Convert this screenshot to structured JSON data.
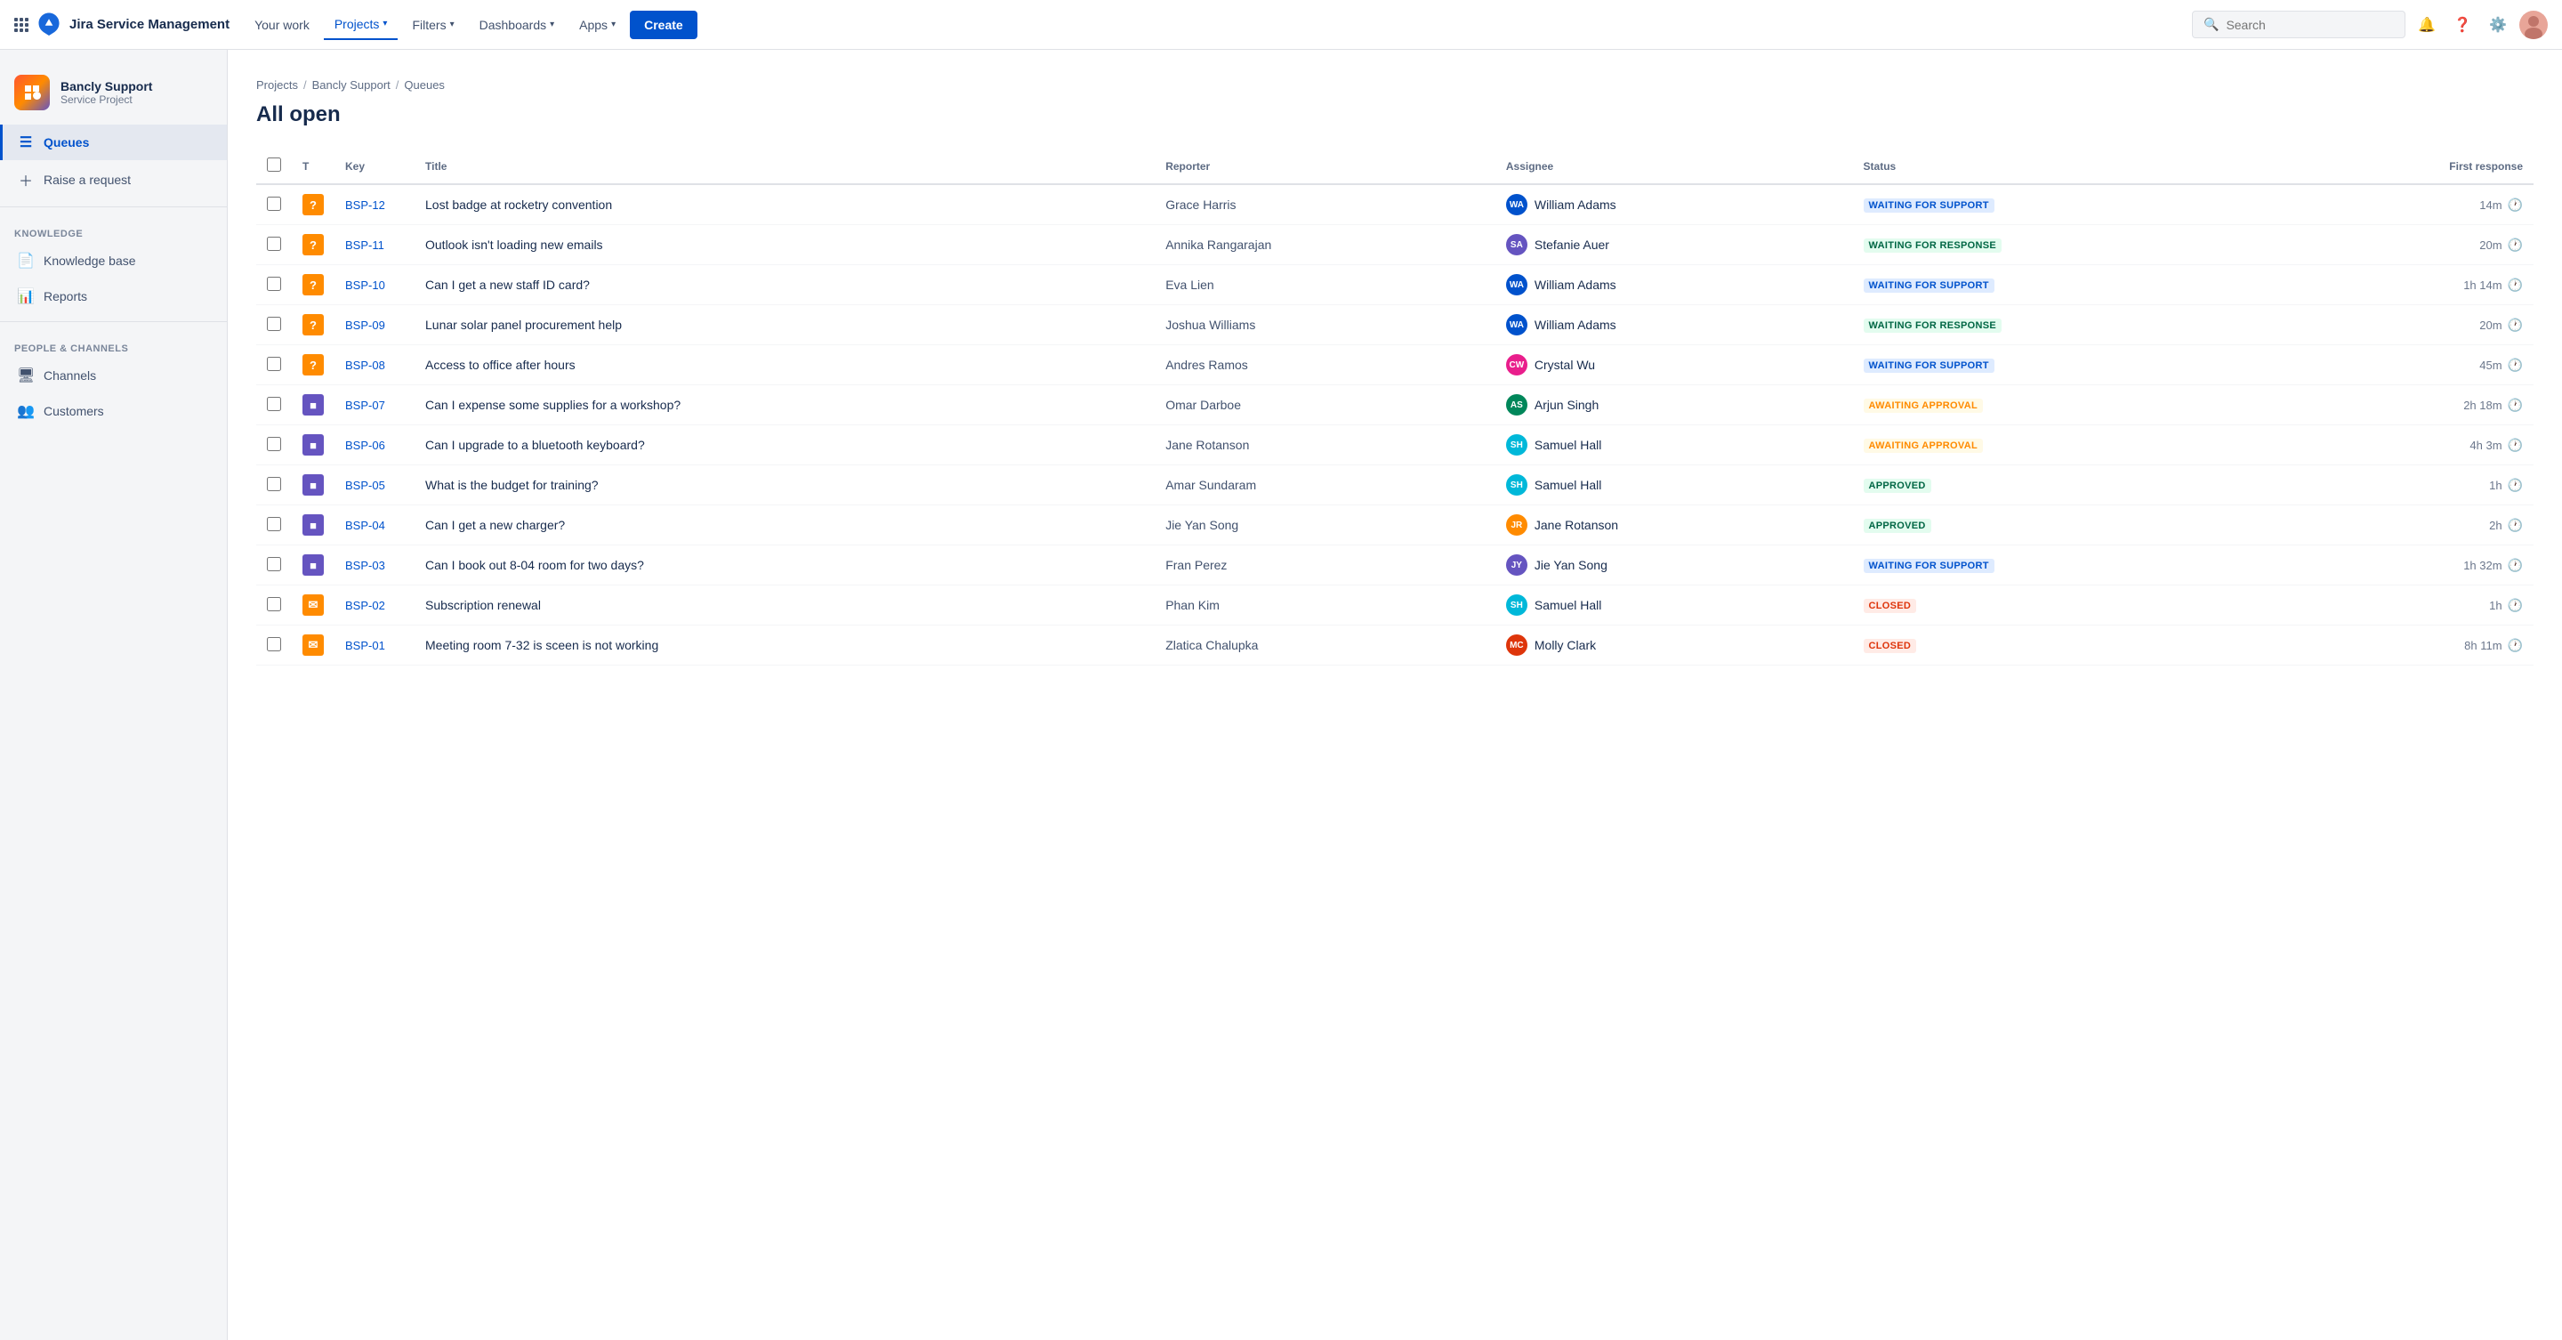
{
  "topnav": {
    "app_name": "Jira Service Management",
    "your_work": "Your work",
    "projects": "Projects",
    "filters": "Filters",
    "dashboards": "Dashboards",
    "apps": "Apps",
    "create": "Create",
    "search_placeholder": "Search"
  },
  "sidebar": {
    "project_name": "Bancly Support",
    "project_type": "Service Project",
    "queues_label": "Queues",
    "raise_request_label": "Raise a request",
    "knowledge_section": "KNOWLEDGE",
    "knowledge_base_label": "Knowledge base",
    "reports_label": "Reports",
    "people_channels_section": "PEOPLE & CHANNELS",
    "channels_label": "Channels",
    "customers_label": "Customers"
  },
  "breadcrumb": {
    "projects": "Projects",
    "bancly_support": "Bancly Support",
    "queues": "Queues"
  },
  "page_title": "All open",
  "table": {
    "cols": {
      "type": "T",
      "key": "Key",
      "title": "Title",
      "reporter": "Reporter",
      "assignee": "Assignee",
      "status": "Status",
      "first_response": "First response"
    },
    "rows": [
      {
        "key": "BSP-12",
        "type": "question",
        "title": "Lost badge at rocketry convention",
        "reporter": "Grace Harris",
        "assignee": "William Adams",
        "assignee_initials": "WA",
        "assignee_color": "av-blue",
        "status": "WAITING FOR SUPPORT",
        "status_class": "status-waiting-support",
        "first_response": "14m"
      },
      {
        "key": "BSP-11",
        "type": "question",
        "title": "Outlook isn't loading new emails",
        "reporter": "Annika Rangarajan",
        "assignee": "Stefanie Auer",
        "assignee_initials": "SA",
        "assignee_color": "av-purple",
        "status": "WAITING FOR RESPONSE",
        "status_class": "status-waiting-response",
        "first_response": "20m"
      },
      {
        "key": "BSP-10",
        "type": "question",
        "title": "Can I get a new staff ID card?",
        "reporter": "Eva Lien",
        "assignee": "William Adams",
        "assignee_initials": "WA",
        "assignee_color": "av-blue",
        "status": "WAITING FOR SUPPORT",
        "status_class": "status-waiting-support",
        "first_response": "1h 14m"
      },
      {
        "key": "BSP-09",
        "type": "question",
        "title": "Lunar solar panel procurement help",
        "reporter": "Joshua Williams",
        "assignee": "William Adams",
        "assignee_initials": "WA",
        "assignee_color": "av-blue",
        "status": "WAITING FOR RESPONSE",
        "status_class": "status-waiting-response",
        "first_response": "20m"
      },
      {
        "key": "BSP-08",
        "type": "question",
        "title": "Access to office after hours",
        "reporter": "Andres Ramos",
        "assignee": "Crystal Wu",
        "assignee_initials": "CW",
        "assignee_color": "av-pink",
        "status": "WAITING FOR SUPPORT",
        "status_class": "status-waiting-support",
        "first_response": "45m"
      },
      {
        "key": "BSP-07",
        "type": "change",
        "title": "Can I expense some supplies for a workshop?",
        "reporter": "Omar Darboe",
        "assignee": "Arjun Singh",
        "assignee_initials": "AS",
        "assignee_color": "av-green",
        "status": "AWAITING APPROVAL",
        "status_class": "status-awaiting-approval",
        "first_response": "2h 18m"
      },
      {
        "key": "BSP-06",
        "type": "change",
        "title": "Can I upgrade to a bluetooth keyboard?",
        "reporter": "Jane Rotanson",
        "assignee": "Samuel Hall",
        "assignee_initials": "SH",
        "assignee_color": "av-teal",
        "status": "AWAITING APPROVAL",
        "status_class": "status-awaiting-approval",
        "first_response": "4h 3m"
      },
      {
        "key": "BSP-05",
        "type": "change",
        "title": "What is the budget for training?",
        "reporter": "Amar Sundaram",
        "assignee": "Samuel Hall",
        "assignee_initials": "SH",
        "assignee_color": "av-teal",
        "status": "APPROVED",
        "status_class": "status-approved",
        "first_response": "1h"
      },
      {
        "key": "BSP-04",
        "type": "change",
        "title": "Can I get a new charger?",
        "reporter": "Jie Yan Song",
        "assignee": "Jane Rotanson",
        "assignee_initials": "JR",
        "assignee_color": "av-orange",
        "status": "APPROVED",
        "status_class": "status-approved",
        "first_response": "2h"
      },
      {
        "key": "BSP-03",
        "type": "change",
        "title": "Can I book out 8-04 room for two days?",
        "reporter": "Fran Perez",
        "assignee": "Jie Yan Song",
        "assignee_initials": "JY",
        "assignee_color": "av-purple",
        "status": "WAITING FOR SUPPORT",
        "status_class": "status-waiting-support",
        "first_response": "1h 32m"
      },
      {
        "key": "BSP-02",
        "type": "email",
        "title": "Subscription renewal",
        "reporter": "Phan Kim",
        "assignee": "Samuel Hall",
        "assignee_initials": "SH",
        "assignee_color": "av-teal",
        "status": "CLOSED",
        "status_class": "status-closed",
        "first_response": "1h"
      },
      {
        "key": "BSP-01",
        "type": "email",
        "title": "Meeting room 7-32 is sceen is not working",
        "reporter": "Zlatica Chalupka",
        "assignee": "Molly Clark",
        "assignee_initials": "MC",
        "assignee_color": "av-red",
        "status": "CLOSED",
        "status_class": "status-closed",
        "first_response": "8h 11m"
      }
    ]
  }
}
